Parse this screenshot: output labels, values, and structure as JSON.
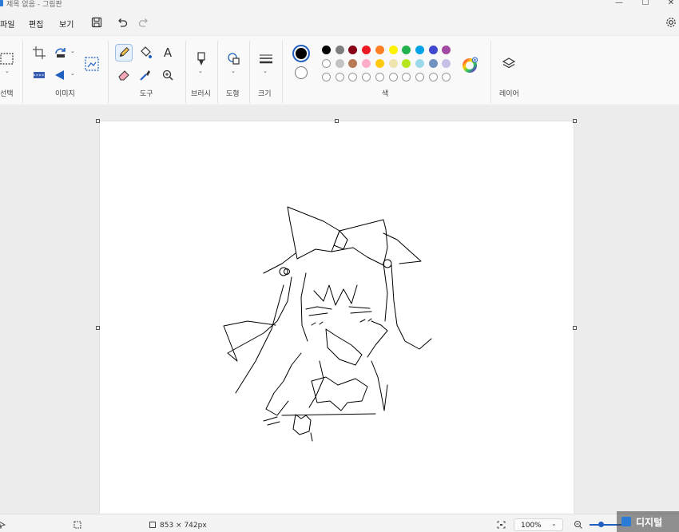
{
  "window": {
    "title": "제목 없음 - 그림판",
    "minimize": "—",
    "maximize": "☐",
    "close": "✕"
  },
  "menu": {
    "file": "파일",
    "edit": "편집",
    "view": "보기"
  },
  "ribbon": {
    "groups": {
      "select": "선택",
      "image": "이미지",
      "tools": "도구",
      "brushes": "브러시",
      "shapes": "도형",
      "size": "크기",
      "colors": "색",
      "layers": "레이어"
    },
    "text_tool_glyph": "A",
    "palette_row1": [
      "#000000",
      "#7f7f7f",
      "#880015",
      "#ed1c24",
      "#ff7f27",
      "#fff200",
      "#22b14c",
      "#00a2e8",
      "#3f48cc",
      "#a349a4"
    ],
    "palette_row2": [
      "#ffffff",
      "#c3c3c3",
      "#b97a57",
      "#ffaec9",
      "#ffc90e",
      "#efe4b0",
      "#b5e61d",
      "#99d9ea",
      "#7092be",
      "#c8bfe7"
    ],
    "primary_color": "#000000",
    "secondary_color": "#ffffff"
  },
  "status": {
    "canvas_size": "853 × 742px",
    "zoom": "100%"
  },
  "watermark": {
    "text": "디지털"
  }
}
